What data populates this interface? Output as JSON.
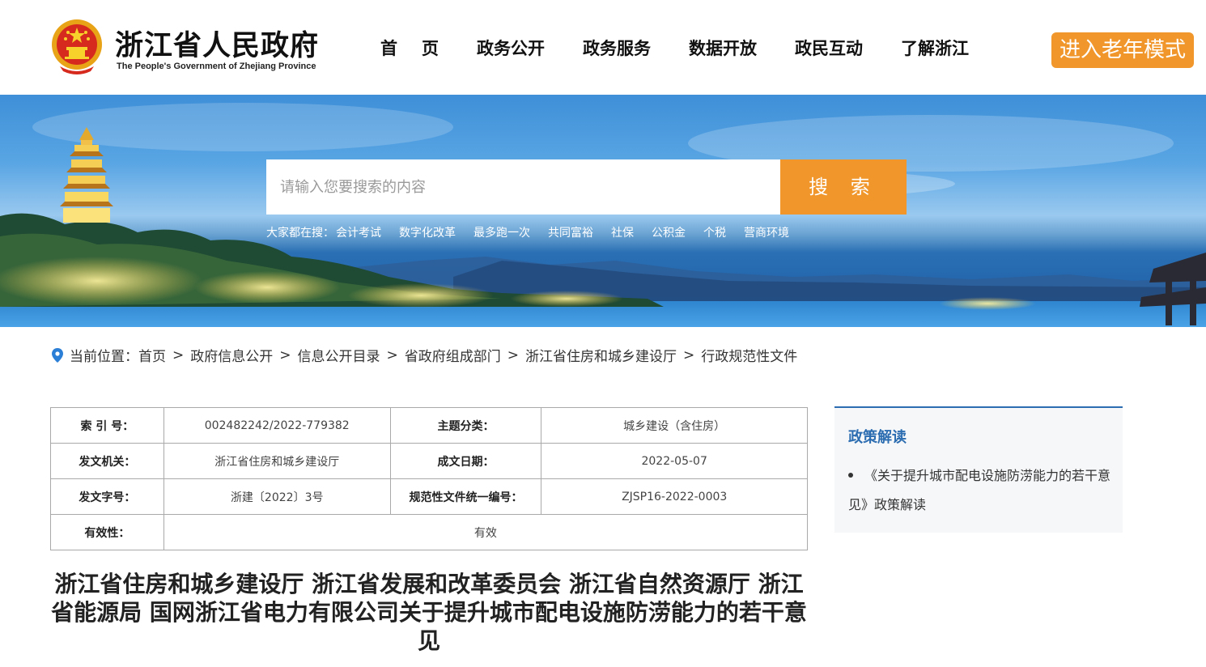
{
  "header": {
    "site_title": "浙江省人民政府",
    "site_title_en": "The People's Government of Zhejiang Province",
    "nav": [
      "首页",
      "政务公开",
      "政务服务",
      "数据开放",
      "政民互动",
      "了解浙江"
    ],
    "elder_mode": "进入老年模式"
  },
  "search": {
    "placeholder": "请输入您要搜索的内容",
    "button": "搜 索",
    "hot_label": "大家都在搜：",
    "hot_items": [
      "会计考试",
      "数字化改革",
      "最多跑一次",
      "共同富裕",
      "社保",
      "公积金",
      "个税",
      "营商环境"
    ]
  },
  "breadcrumb": {
    "label": "当前位置：",
    "items": [
      "首页",
      "政府信息公开",
      "信息公开目录",
      "省政府组成部门",
      "浙江省住房和城乡建设厅",
      "行政规范性文件"
    ],
    "separator": ">"
  },
  "info": {
    "index_no_label": "索 引 号：",
    "index_no": "002482242/2022-779382",
    "category_label": "主题分类：",
    "category": "城乡建设（含住房）",
    "issuer_label": "发文机关：",
    "issuer": "浙江省住房和城乡建设厅",
    "date_label": "成文日期：",
    "date": "2022-05-07",
    "doc_no_label": "发文字号：",
    "doc_no": "浙建〔2022〕3号",
    "unified_no_label": "规范性文件统一编号：",
    "unified_no": "ZJSP16-2022-0003",
    "validity_label": "有效性：",
    "validity": "有效"
  },
  "document": {
    "title": "浙江省住房和城乡建设厅 浙江省发展和改革委员会 浙江省自然资源厅 浙江省能源局 国网浙江省电力有限公司关于提升城市配电设施防涝能力的若干意见"
  },
  "side": {
    "title": "政策解读",
    "items": [
      "《关于提升城市配电设施防涝能力的若干意见》政策解读"
    ]
  },
  "colors": {
    "accent": "#f0962a",
    "link_blue": "#2c6db1"
  }
}
